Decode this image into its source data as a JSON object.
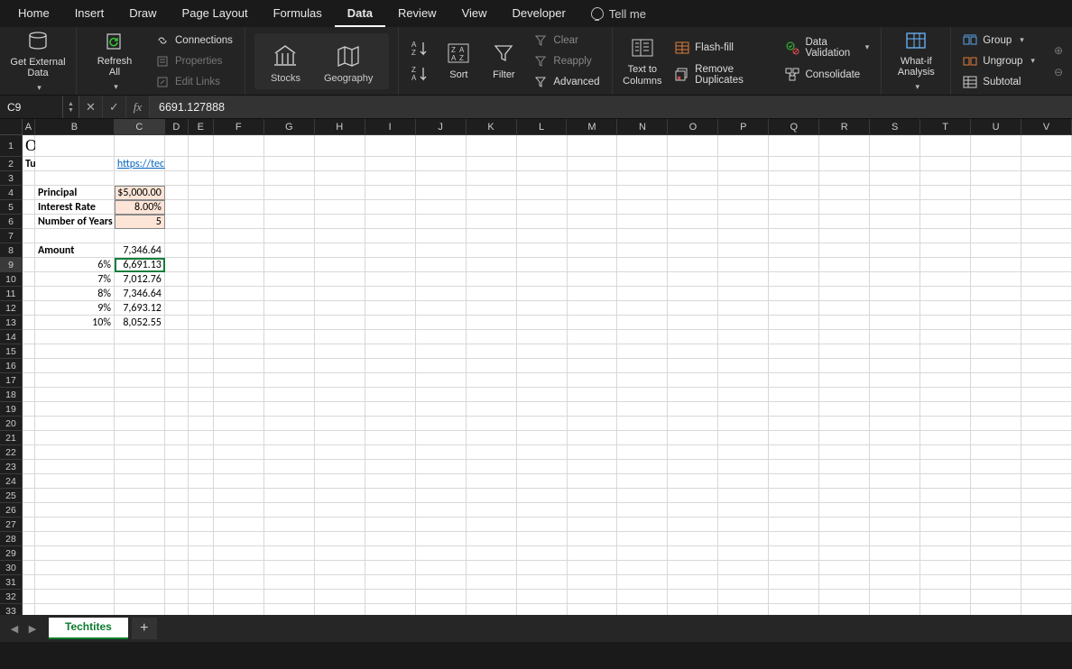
{
  "menu": {
    "tabs": [
      "Home",
      "Insert",
      "Draw",
      "Page Layout",
      "Formulas",
      "Data",
      "Review",
      "View",
      "Developer"
    ],
    "active_index": 5,
    "tellme": "Tell me"
  },
  "ribbon": {
    "get_external": "Get External\nData",
    "refresh_all": "Refresh\nAll",
    "connections": "Connections",
    "properties": "Properties",
    "edit_links": "Edit Links",
    "stocks": "Stocks",
    "geography": "Geography",
    "sort": "Sort",
    "filter": "Filter",
    "clear": "Clear",
    "reapply": "Reapply",
    "advanced": "Advanced",
    "text_to_columns": "Text to\nColumns",
    "flash_fill": "Flash-fill",
    "remove_duplicates": "Remove Duplicates",
    "data_validation": "Data Validation",
    "consolidate": "Consolidate",
    "what_if": "What-if\nAnalysis",
    "group": "Group",
    "ungroup": "Ungroup",
    "subtotal": "Subtotal"
  },
  "formula_bar": {
    "cell_ref": "C9",
    "value": "6691.127888"
  },
  "columns": [
    "A",
    "B",
    "C",
    "D",
    "E",
    "F",
    "G",
    "H",
    "I",
    "J",
    "K",
    "L",
    "M",
    "N",
    "O",
    "P",
    "Q",
    "R",
    "S",
    "T",
    "U",
    "V"
  ],
  "col_widths": {
    "A": 14,
    "B": 88,
    "C": 56,
    "D": 26,
    "E": 28,
    "default": 56
  },
  "selected_col": "C",
  "selected_row": 9,
  "row_count": 36,
  "sheet": {
    "title": "One Variable Data Table",
    "tutorial_label": "Tutorial URL:",
    "tutorial_link": "https://techtites.com/data-tables-in-excel-tutorial-thursday/",
    "inputs": [
      {
        "label": "Principal",
        "value": "$5,000.00"
      },
      {
        "label": "Interest Rate",
        "value": "8.00%"
      },
      {
        "label": "Number of Years",
        "value": "5"
      }
    ],
    "amount_label": "Amount",
    "amount_header_value": "7,346.64",
    "data_table": [
      {
        "rate": "6%",
        "amount": "6,691.13"
      },
      {
        "rate": "7%",
        "amount": "7,012.76"
      },
      {
        "rate": "8%",
        "amount": "7,346.64"
      },
      {
        "rate": "9%",
        "amount": "7,693.12"
      },
      {
        "rate": "10%",
        "amount": "8,052.55"
      }
    ]
  },
  "sheet_tab": "Techtites"
}
